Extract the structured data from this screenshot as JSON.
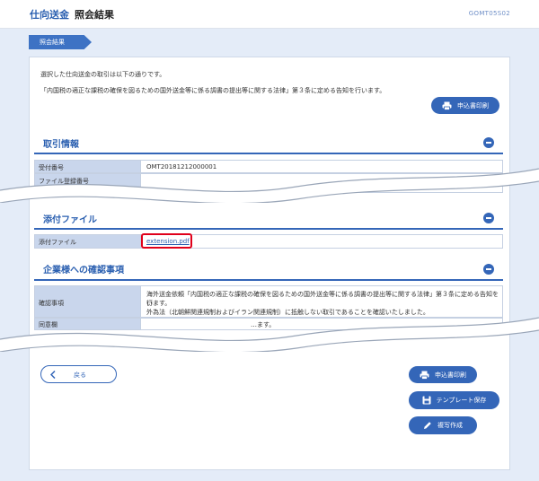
{
  "header": {
    "app_title": "仕向送金",
    "page_title": "照会結果",
    "screen_code": "GOMT05S02"
  },
  "breadcrumb": {
    "label": "照会結果"
  },
  "intro": {
    "line1": "選択した仕向送金の取引は以下の通りです。",
    "line2": "「内国税の適正な課税の確保を図るための国外送金等に係る調書の提出等に関する法律」第３条に定める告知を行います。"
  },
  "buttons": {
    "print_application": "申込書印刷",
    "back": "戻る",
    "save_template": "テンプレート保存",
    "copy_create": "複写作成"
  },
  "sections": {
    "transaction": {
      "title": "取引情報",
      "rows": [
        {
          "label": "受付番号",
          "value": "OMT20181212000001"
        },
        {
          "label": "ファイル登録番号",
          "value": ""
        }
      ]
    },
    "attachment": {
      "title": "添付ファイル",
      "rows": [
        {
          "label": "添付ファイル",
          "value": "extension.pdf"
        }
      ]
    },
    "confirmation": {
      "title": "企業様への確認事項",
      "rows": [
        {
          "label": "確認事項",
          "value1": "海外送金依頼「内国税の適正な課税の確保を図るための国外送金等に係る調書の提出等に関する法律」第３条に定める告知を行",
          "value2": "います。",
          "value3": "外為法（北朝鮮関連規制およびイラン関連規制）に抵触しない取引であることを確認いたしました。"
        },
        {
          "label": "同意欄",
          "value": "…ます。"
        }
      ]
    }
  },
  "colors": {
    "accent": "#3466b8",
    "highlight": "#e0001b",
    "label_bg": "#c9d6ec",
    "page_bg": "#e4ecf8"
  }
}
